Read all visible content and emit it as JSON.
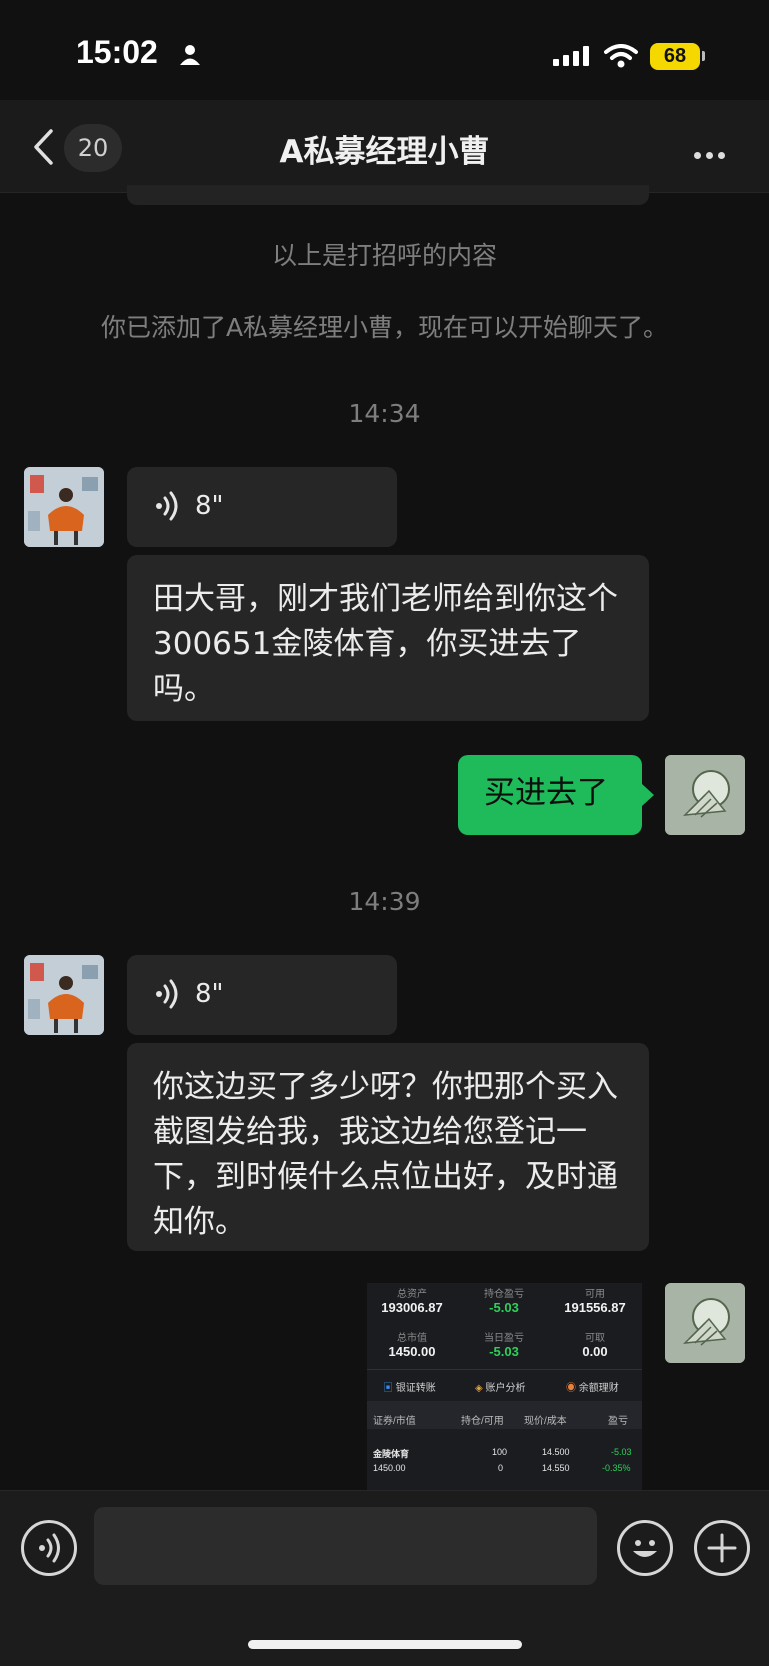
{
  "status_bar": {
    "time": "15:02",
    "battery": "68"
  },
  "header": {
    "unread_count": "20",
    "title": "A私募经理小曹"
  },
  "system": {
    "greeting_note": "以上是打招呼的内容",
    "added_note": "你已添加了A私募经理小曹，现在可以开始聊天了。"
  },
  "messages": {
    "time1": "14:34",
    "voice1": "8\"",
    "text1": "田大哥，刚才我们老师给到你这个300651金陵体育，你买进去了吗。",
    "reply1": "买进去了",
    "time2": "14:39",
    "voice2": "8\"",
    "text2": "你这边买了多少呀？你把那个买入截图发给我，我这边给您登记一下，到时候什么点位出好，及时通知你。"
  },
  "screenshot": {
    "total_assets_label": "总资产",
    "total_assets": "193006.87",
    "holding_pnl_label": "持仓盈亏",
    "holding_pnl": "-5.03",
    "available_label": "可用",
    "available": "191556.87",
    "market_value_label": "总市值",
    "market_value": "1450.00",
    "daily_pnl_label": "当日盈亏",
    "daily_pnl": "-5.03",
    "withdrawable_label": "可取",
    "withdrawable": "0.00",
    "tool_transfer": "银证转账",
    "tool_analysis": "账户分析",
    "tool_finance": "余额理财",
    "col_security": "证券/市值",
    "col_holding": "持仓/可用",
    "col_price": "现价/成本",
    "col_pnl": "盈亏",
    "row_name": "金陵体育",
    "row_value": "1450.00",
    "row_hold": "100",
    "row_avail": "0",
    "row_price": "14.500",
    "row_cost": "14.550",
    "row_pnl": "-5.03",
    "row_pnl_pct": "-0.35%",
    "colors": {
      "loss": "#2fd05a"
    }
  },
  "colors": {
    "accent": "#1fba5a",
    "background": "#111111"
  }
}
